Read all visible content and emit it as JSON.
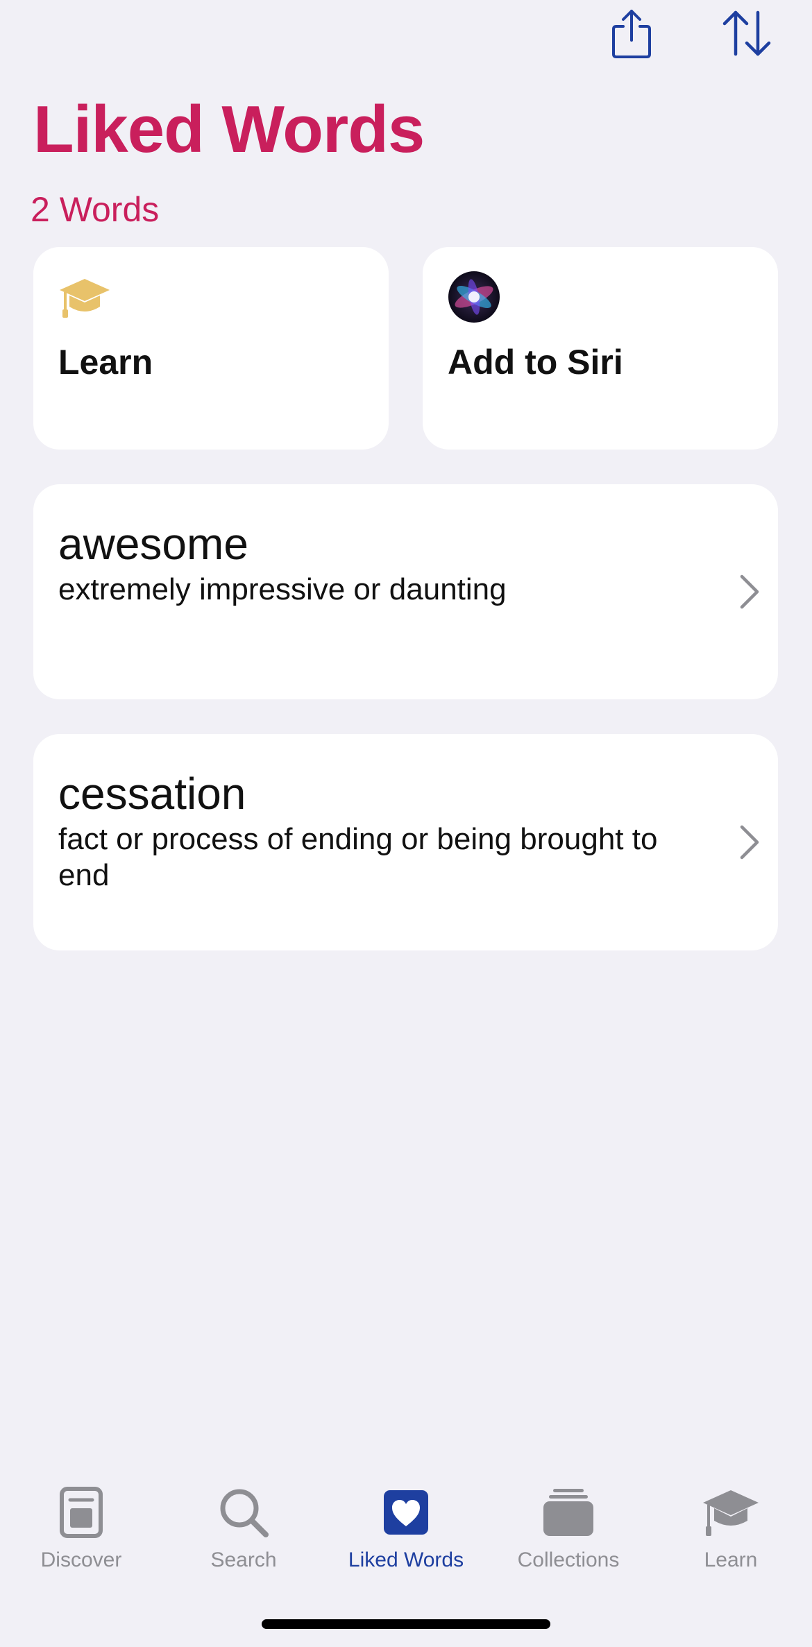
{
  "colors": {
    "accent": "#C91F5C",
    "tint": "#1E3FA0",
    "inactive": "#8E8E93",
    "background": "#F1F0F6",
    "card": "#FFFFFF"
  },
  "header": {
    "title": "Liked Words",
    "count_label": "2 Words",
    "actions": [
      {
        "icon": "share-icon"
      },
      {
        "icon": "sort-icon"
      }
    ]
  },
  "tiles": [
    {
      "label": "Learn",
      "icon": "graduation-cap-icon"
    },
    {
      "label": "Add to Siri",
      "icon": "siri-icon"
    }
  ],
  "words": [
    {
      "word": "awesome",
      "definition": "extremely impressive or daunting"
    },
    {
      "word": "cessation",
      "definition": "fact or process of ending or being brought to end"
    }
  ],
  "tabbar": {
    "active": "Liked Words",
    "tabs": [
      {
        "label": "Discover",
        "icon": "discover-icon"
      },
      {
        "label": "Search",
        "icon": "magnifier-icon"
      },
      {
        "label": "Liked Words",
        "icon": "heart-icon"
      },
      {
        "label": "Collections",
        "icon": "collections-icon"
      },
      {
        "label": "Learn",
        "icon": "graduation-cap-icon"
      }
    ]
  }
}
